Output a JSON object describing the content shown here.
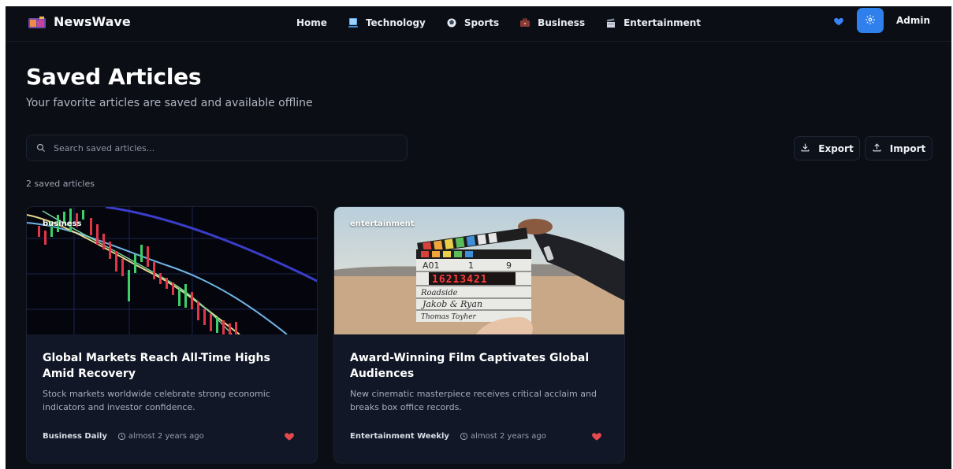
{
  "app": {
    "brand": "NewsWave"
  },
  "nav": {
    "items": [
      {
        "label": "Home",
        "icon": "none"
      },
      {
        "label": "Technology",
        "icon": "laptop-icon"
      },
      {
        "label": "Sports",
        "icon": "ball-icon"
      },
      {
        "label": "Business",
        "icon": "briefcase-icon"
      },
      {
        "label": "Entertainment",
        "icon": "clapper-icon"
      }
    ],
    "user": "Admin"
  },
  "header": {
    "title": "Saved Articles",
    "subtitle": "Your favorite articles are saved and available offline"
  },
  "search": {
    "placeholder": "Search saved articles...",
    "value": ""
  },
  "actions": {
    "export_label": "Export",
    "import_label": "Import"
  },
  "summary": {
    "count_text": "2 saved articles"
  },
  "articles": [
    {
      "category": "business",
      "title": "Global Markets Reach All-Time Highs Amid Recovery",
      "description": "Stock markets worldwide celebrate strong economic indicators and investor confidence.",
      "source": "Business Daily",
      "time": "almost 2 years ago",
      "saved": true
    },
    {
      "category": "entertainment",
      "title": "Award-Winning Film Captivates Global Audiences",
      "description": "New cinematic masterpiece receives critical acclaim and breaks box office records.",
      "source": "Entertainment Weekly",
      "time": "almost 2 years ago",
      "saved": true
    }
  ],
  "clapperboard": {
    "digits": "16213421",
    "row1": "A01",
    "row2": "1",
    "row3": "9",
    "roll": "Roadside",
    "names": "Jakob & Ryan",
    "camera": "Thomas Toyher"
  },
  "colors": {
    "background": "#0b0e14",
    "card": "#111726",
    "accent": "#2f80ed",
    "heart": "#e5484d",
    "heart_nav": "#3b82f6"
  }
}
